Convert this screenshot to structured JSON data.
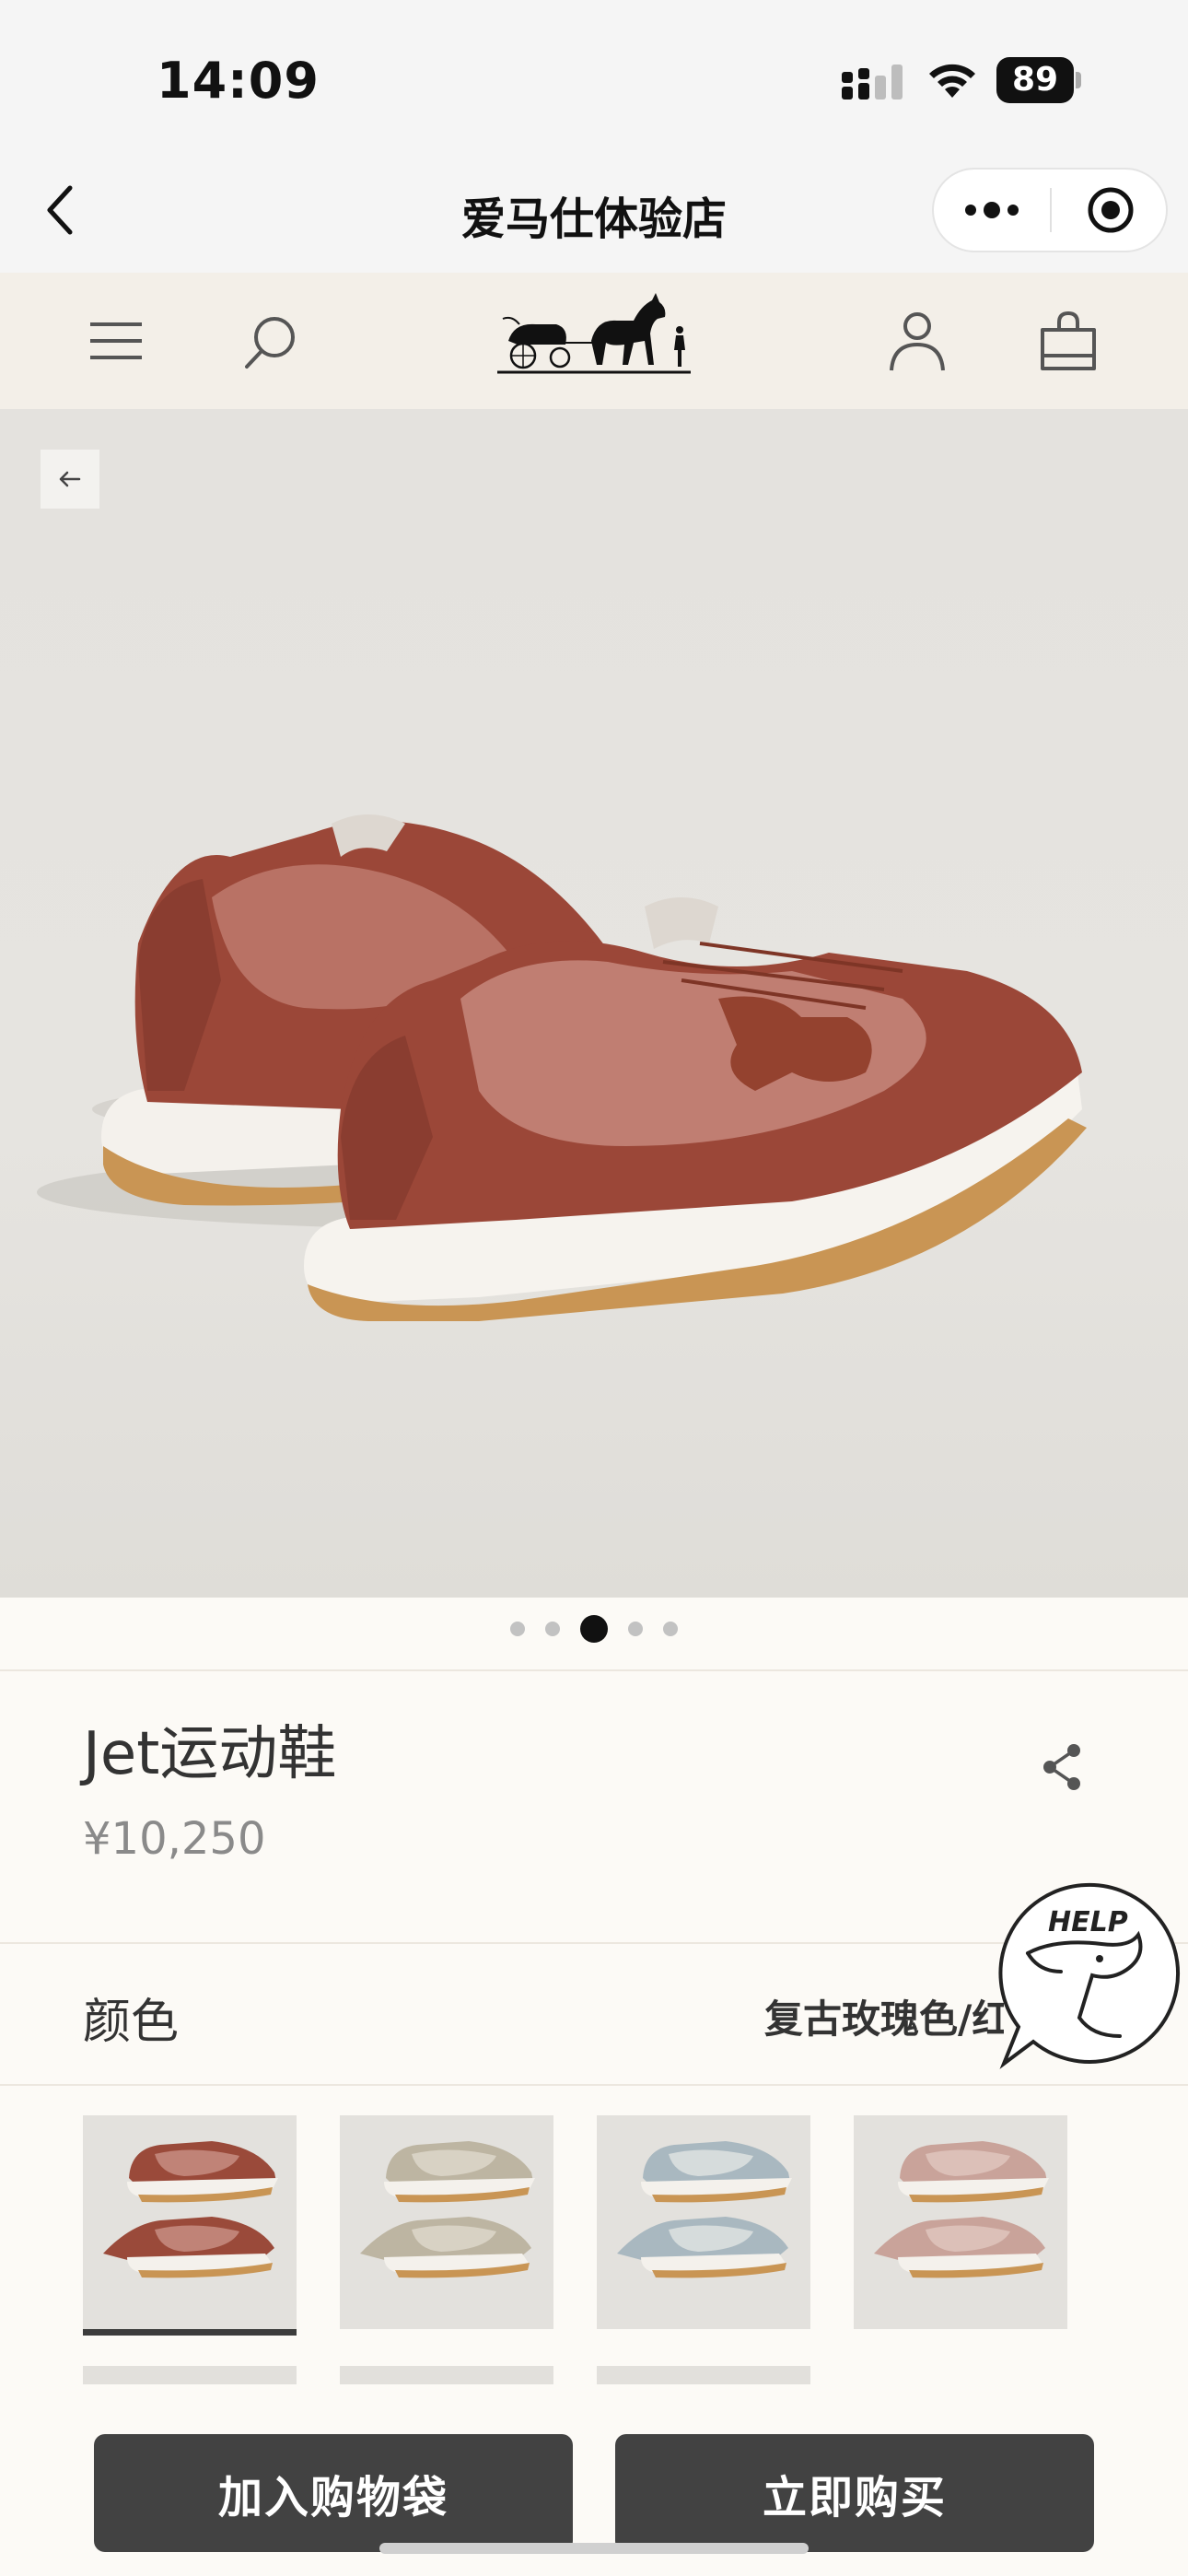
{
  "status_bar": {
    "time": "14:09",
    "battery": "89"
  },
  "header": {
    "title": "爱马仕体验店"
  },
  "store_nav": {
    "icons": [
      "menu-icon",
      "search-icon",
      "hermes-logo",
      "account-icon",
      "shopping-bag-icon"
    ]
  },
  "gallery": {
    "dot_count": 5,
    "active_index": 2
  },
  "product": {
    "name": "Jet运动鞋",
    "price": "¥10,250"
  },
  "color": {
    "label": "颜色",
    "selected_value": "复古玫瑰色/红",
    "swatches": [
      {
        "name": "rust-red",
        "upper": "#9a4a3a",
        "panel": "#c08377",
        "selected": true
      },
      {
        "name": "beige-grey",
        "upper": "#bdb5a2",
        "panel": "#d8d2c4",
        "selected": false
      },
      {
        "name": "light-blue",
        "upper": "#a9b8c0",
        "panel": "#d6dcdc",
        "selected": false
      },
      {
        "name": "soft-pink",
        "upper": "#c9a39a",
        "panel": "#dcc0b8",
        "selected": false
      }
    ]
  },
  "help": {
    "label": "HELP"
  },
  "actions": {
    "add_to_bag": "加入购物袋",
    "buy_now": "立即购买"
  },
  "colors": {
    "button_bg": "#424242",
    "page_bg": "#fcfaf6",
    "nav_bg": "#f3efe8"
  }
}
